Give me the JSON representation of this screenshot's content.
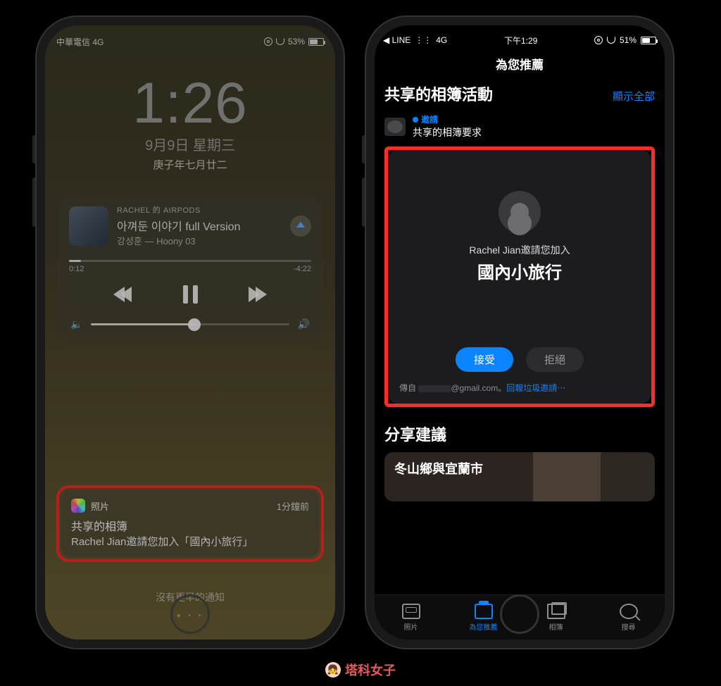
{
  "phone1": {
    "status": {
      "carrier": "中華電信  4G",
      "battery": "53%"
    },
    "clock": {
      "time": "1:26",
      "date": "9月9日 星期三",
      "alt": "庚子年七月廿二"
    },
    "music": {
      "source": "RACHEL 的 AIRPODS",
      "title": "아껴둔 이야기 full Version",
      "artist": "강성훈 — Hoony 03",
      "elapsed": "0:12",
      "remaining": "-4:22"
    },
    "notification": {
      "app": "照片",
      "when": "1分鐘前",
      "title": "共享的相簿",
      "body": "Rachel Jian邀請您加入「國內小旅行」"
    },
    "noEarlier": "沒有更早的通知"
  },
  "phone2": {
    "status": {
      "back": "◀ LINE",
      "network": "4G",
      "time": "下午1:29",
      "battery": "51%"
    },
    "nav": {
      "title": "為您推薦"
    },
    "section": {
      "heading": "共享的相簿活動",
      "showAll": "顯示全部"
    },
    "request": {
      "badge": "邀請",
      "text": "共享的相簿要求"
    },
    "invite": {
      "line": "Rachel Jian邀請您加入",
      "album": "國內小旅行",
      "accept": "接受",
      "reject": "拒絕",
      "fromPrefix": "傳自 ",
      "fromDomain": "@gmail.com",
      "dot": "。",
      "report": "回報垃圾邀請⋯"
    },
    "share": {
      "heading": "分享建議",
      "card": "冬山鄉與宜蘭市"
    },
    "tabs": {
      "library": "照片",
      "forYou": "為您推薦",
      "albums": "相簿",
      "search": "搜尋"
    }
  },
  "watermark": "塔科女子"
}
